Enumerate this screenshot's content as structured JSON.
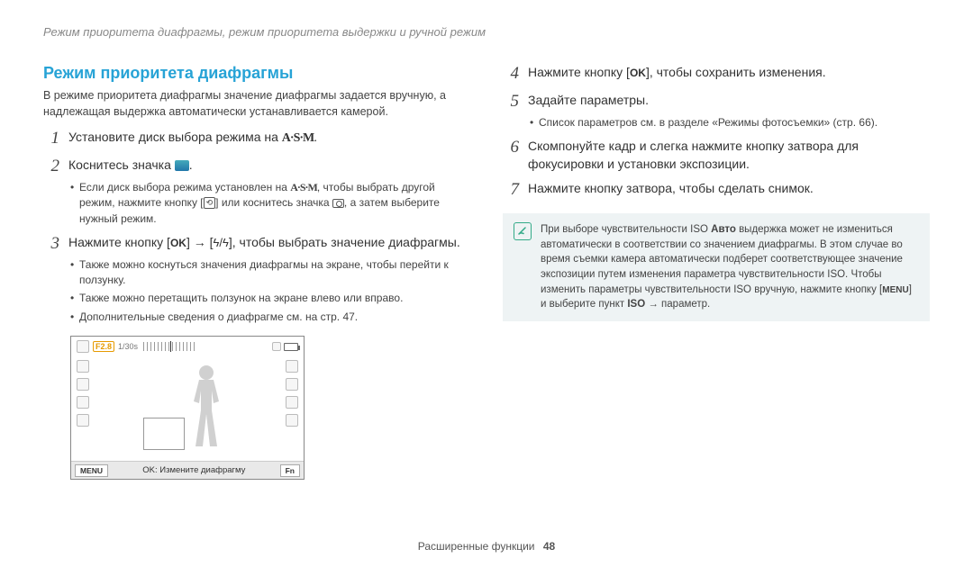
{
  "running_header": "Режим приоритета диафрагмы, режим приоритета выдержки и ручной режим",
  "section_title": "Режим приоритета диафрагмы",
  "intro": "В режиме приоритета диафрагмы значение диафрагмы задается вручную, а надлежащая выдержка автоматически устанавливается камерой.",
  "steps_left": {
    "s1_num": "1",
    "s1_a": "Установите диск выбора режима на ",
    "s1_asm": "A·S·M",
    "s1_b": ".",
    "s2_num": "2",
    "s2_a": "Коснитесь значка ",
    "s2_b": ".",
    "s2_sub_a": "Если диск выбора режима установлен на ",
    "s2_sub_asm": "A·S·M",
    "s2_sub_b": ", чтобы выбрать другой режим, нажмите кнопку [",
    "s2_sub_btn": "⟲",
    "s2_sub_c": "] или коснитесь значка ",
    "s2_sub_d": ", а затем выберите нужный режим.",
    "s3_num": "3",
    "s3_a": "Нажмите кнопку [",
    "s3_ok": "OK",
    "s3_b": "] → [",
    "s3_flash": "ϟ/",
    "s3_flash2": "ϟ",
    "s3_c": "], чтобы выбрать значение диафрагмы.",
    "s3_sub1": "Также можно коснуться значения диафрагмы на экране, чтобы перейти к ползунку.",
    "s3_sub2": "Также можно перетащить ползунок на экране влево или вправо.",
    "s3_sub3": "Дополнительные сведения о диафрагме см. на стр. 47."
  },
  "screen": {
    "f_value": "F2.8",
    "shutter": "1/30s",
    "menu": "MENU",
    "bottom_text": "OK: Измените диафрагму",
    "fn": "Fn"
  },
  "steps_right": {
    "s4_num": "4",
    "s4_a": "Нажмите кнопку [",
    "s4_ok": "OK",
    "s4_b": "], чтобы сохранить изменения.",
    "s5_num": "5",
    "s5": "Задайте параметры.",
    "s5_sub": "Список параметров см. в разделе «Режимы фотосъемки» (стр. 66).",
    "s6_num": "6",
    "s6": "Скомпонуйте кадр и слегка нажмите кнопку затвора для фокусировки и установки экспозиции.",
    "s7_num": "7",
    "s7": "Нажмите кнопку затвора, чтобы сделать снимок."
  },
  "note": {
    "text_a": "При выборе чувствительности ISO ",
    "auto": "Авто",
    "text_b": " выдержка может не измениться автоматически в соответствии со значением диафрагмы. В этом случае во время съемки камера автоматически подберет соответствующее значение экспозиции путем изменения параметра чувствительности ISO. Чтобы изменить параметры чувствительности ISO вручную, нажмите кнопку [",
    "menu": "MENU",
    "text_c": "] и выберите пункт ",
    "iso": "ISO",
    "text_d": " → параметр."
  },
  "footer": {
    "label": "Расширенные функции",
    "page": "48"
  }
}
